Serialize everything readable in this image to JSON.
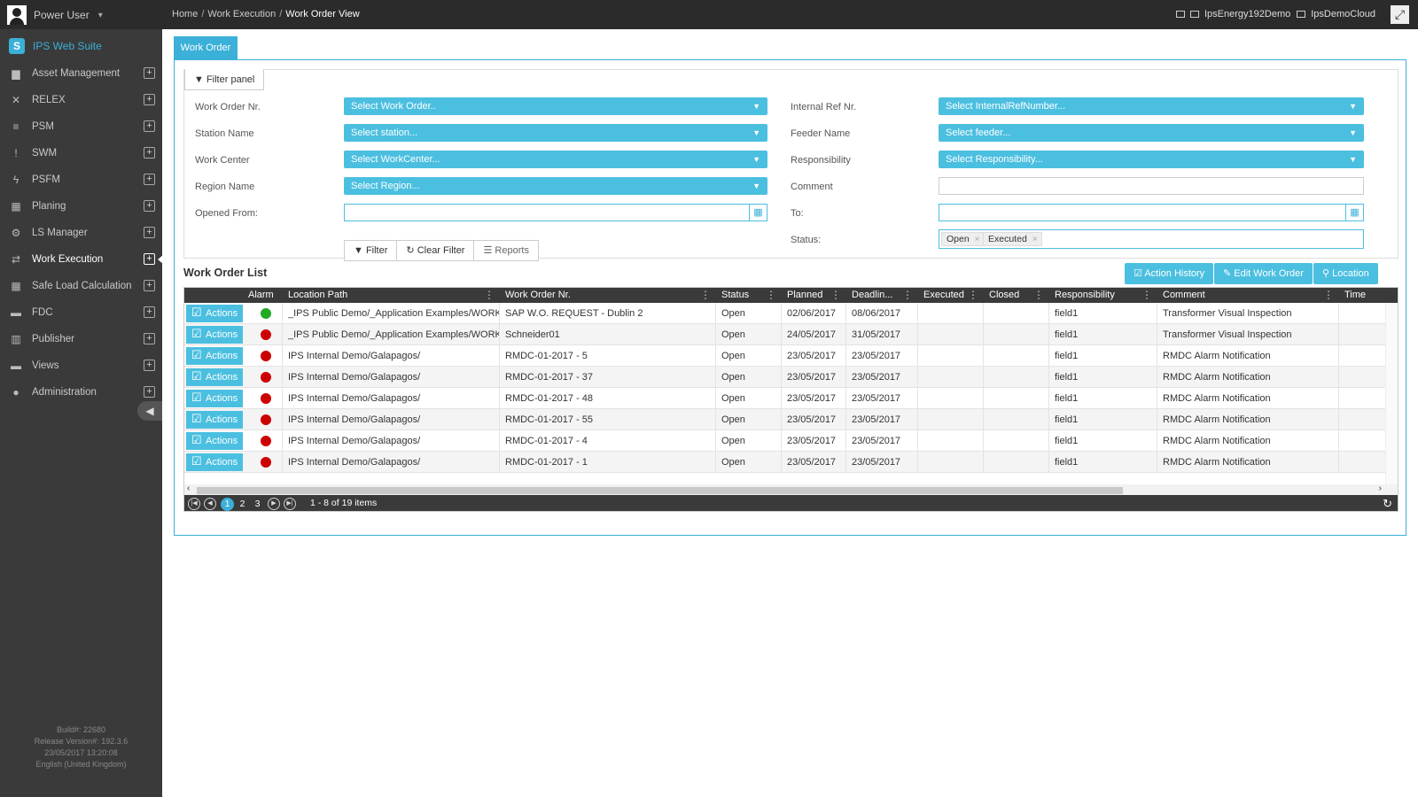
{
  "topbar": {
    "user": "Power User",
    "breadcrumb": [
      "Home",
      "Work Execution",
      "Work Order View"
    ],
    "env1": "IpsEnergy192Demo",
    "env2": "IpsDemoCloud"
  },
  "sidebar": {
    "brand": "IPS Web Suite",
    "items": [
      {
        "label": "Asset Management",
        "icon": "folder-icon",
        "glyph": "▆"
      },
      {
        "label": "RELEX",
        "icon": "shuffle-icon",
        "glyph": "✕"
      },
      {
        "label": "PSM",
        "icon": "database-icon",
        "glyph": "≡"
      },
      {
        "label": "SWM",
        "icon": "exclamation-icon",
        "glyph": "!"
      },
      {
        "label": "PSFM",
        "icon": "bolt-icon",
        "glyph": "ϟ"
      },
      {
        "label": "Planing",
        "icon": "calendar-icon",
        "glyph": "▦"
      },
      {
        "label": "LS Manager",
        "icon": "cogs-icon",
        "glyph": "⚙"
      },
      {
        "label": "Work Execution",
        "icon": "exchange-icon",
        "glyph": "⇄"
      },
      {
        "label": "Safe Load Calculation",
        "icon": "grid-icon",
        "glyph": "▦"
      },
      {
        "label": "FDC",
        "icon": "archive-icon",
        "glyph": "▬"
      },
      {
        "label": "Publisher",
        "icon": "bar-chart-icon",
        "glyph": "▥"
      },
      {
        "label": "Views",
        "icon": "archive-icon",
        "glyph": "▬"
      },
      {
        "label": "Administration",
        "icon": "user-icon",
        "glyph": "●"
      }
    ],
    "build": [
      "Build#: 22680",
      "Release Version#: 192.3.6",
      "23/05/2017 13:20:08",
      "English (United Kingdom)"
    ]
  },
  "main": {
    "tab": "Work Order",
    "filter_tab": "Filter panel",
    "filters": {
      "work_order_label": "Work Order Nr.",
      "work_order_placeholder": "Select Work Order..",
      "station_label": "Station Name",
      "station_placeholder": "Select station...",
      "workcenter_label": "Work Center",
      "workcenter_placeholder": "Select WorkCenter...",
      "region_label": "Region Name",
      "region_placeholder": "Select Region...",
      "opened_from_label": "Opened From:",
      "internal_ref_label": "Internal Ref Nr.",
      "internal_ref_placeholder": "Select InternalRefNumber...",
      "feeder_label": "Feeder Name",
      "feeder_placeholder": "Select feeder...",
      "responsibility_label": "Responsibility",
      "responsibility_placeholder": "Select Responsibility...",
      "comment_label": "Comment",
      "to_label": "To:",
      "status_label": "Status:",
      "status_chips": [
        "Open",
        "Executed"
      ]
    },
    "buttons": {
      "filter": "Filter",
      "clear_filter": "Clear Filter",
      "reports": "Reports",
      "action_history": "Action History",
      "edit_work_order": "Edit Work Order",
      "location": "Location"
    },
    "list_title": "Work Order List",
    "columns": [
      "Alarm",
      "Location Path",
      "Work Order Nr.",
      "Status",
      "Planned",
      "Deadlin...",
      "Executed",
      "Closed",
      "Responsibility",
      "Comment",
      "Time"
    ],
    "action_label": "Actions",
    "rows": [
      {
        "alarm": "#22aa22",
        "path": "_IPS Public Demo/_Application Examples/WORK ...",
        "wo": "SAP W.O. REQUEST - Dublin 2",
        "status": "Open",
        "planned": "02/06/2017",
        "deadline": "08/06/2017",
        "executed": "",
        "closed": "",
        "resp": "field1",
        "comment": "Transformer Visual Inspection"
      },
      {
        "alarm": "#cc0000",
        "path": "_IPS Public Demo/_Application Examples/WORK ...",
        "wo": "Schneider01",
        "status": "Open",
        "planned": "24/05/2017",
        "deadline": "31/05/2017",
        "executed": "",
        "closed": "",
        "resp": "field1",
        "comment": "Transformer Visual Inspection"
      },
      {
        "alarm": "#cc0000",
        "path": "IPS Internal Demo/Galapagos/",
        "wo": "RMDC-01-2017 - 5",
        "status": "Open",
        "planned": "23/05/2017",
        "deadline": "23/05/2017",
        "executed": "",
        "closed": "",
        "resp": "field1",
        "comment": "RMDC Alarm Notification"
      },
      {
        "alarm": "#cc0000",
        "path": "IPS Internal Demo/Galapagos/",
        "wo": "RMDC-01-2017 - 37",
        "status": "Open",
        "planned": "23/05/2017",
        "deadline": "23/05/2017",
        "executed": "",
        "closed": "",
        "resp": "field1",
        "comment": "RMDC Alarm Notification"
      },
      {
        "alarm": "#cc0000",
        "path": "IPS Internal Demo/Galapagos/",
        "wo": "RMDC-01-2017 - 48",
        "status": "Open",
        "planned": "23/05/2017",
        "deadline": "23/05/2017",
        "executed": "",
        "closed": "",
        "resp": "field1",
        "comment": "RMDC Alarm Notification"
      },
      {
        "alarm": "#cc0000",
        "path": "IPS Internal Demo/Galapagos/",
        "wo": "RMDC-01-2017 - 55",
        "status": "Open",
        "planned": "23/05/2017",
        "deadline": "23/05/2017",
        "executed": "",
        "closed": "",
        "resp": "field1",
        "comment": "RMDC Alarm Notification"
      },
      {
        "alarm": "#cc0000",
        "path": "IPS Internal Demo/Galapagos/",
        "wo": "RMDC-01-2017 - 4",
        "status": "Open",
        "planned": "23/05/2017",
        "deadline": "23/05/2017",
        "executed": "",
        "closed": "",
        "resp": "field1",
        "comment": "RMDC Alarm Notification"
      },
      {
        "alarm": "#cc0000",
        "path": "IPS Internal Demo/Galapagos/",
        "wo": "RMDC-01-2017 - 1",
        "status": "Open",
        "planned": "23/05/2017",
        "deadline": "23/05/2017",
        "executed": "",
        "closed": "",
        "resp": "field1",
        "comment": "RMDC Alarm Notification"
      }
    ],
    "pager": {
      "pages": [
        "1",
        "2",
        "3"
      ],
      "current": "1",
      "info": "1 - 8 of 19 items"
    }
  },
  "colors": {
    "accent": "#3bb0d8",
    "sidebar": "#3a3a3a",
    "topbar": "#2b2b2b"
  }
}
